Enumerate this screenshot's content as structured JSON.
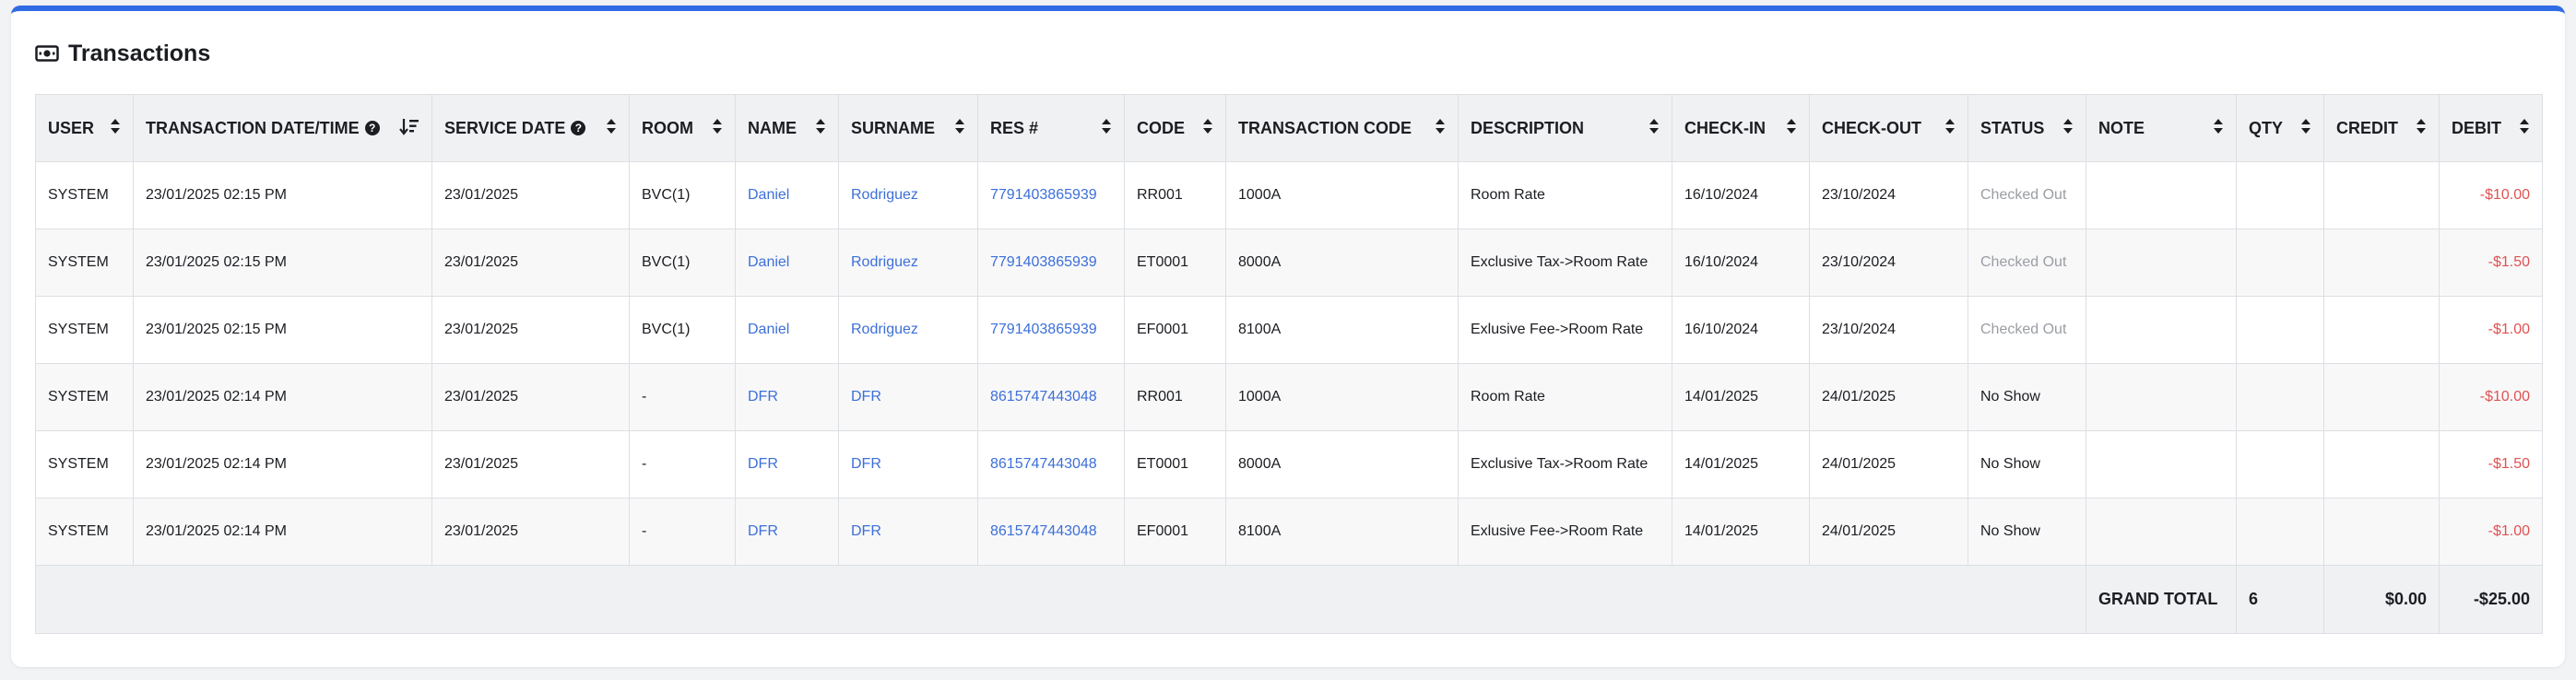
{
  "card": {
    "title": "Transactions",
    "icon": "money-bill-icon"
  },
  "columns": [
    {
      "key": "user",
      "label": "USER",
      "help": false,
      "sort": "both"
    },
    {
      "key": "txn_datetime",
      "label": "TRANSACTION DATE/TIME",
      "help": true,
      "sort": "desc"
    },
    {
      "key": "service_date",
      "label": "SERVICE DATE",
      "help": true,
      "sort": "both"
    },
    {
      "key": "room",
      "label": "ROOM",
      "help": false,
      "sort": "both"
    },
    {
      "key": "name",
      "label": "NAME",
      "help": false,
      "sort": "both"
    },
    {
      "key": "surname",
      "label": "SURNAME",
      "help": false,
      "sort": "both"
    },
    {
      "key": "res",
      "label": "RES #",
      "help": false,
      "sort": "both"
    },
    {
      "key": "code",
      "label": "CODE",
      "help": false,
      "sort": "both"
    },
    {
      "key": "txn_code",
      "label": "TRANSACTION CODE",
      "help": false,
      "sort": "both"
    },
    {
      "key": "description",
      "label": "DESCRIPTION",
      "help": false,
      "sort": "both"
    },
    {
      "key": "checkin",
      "label": "CHECK-IN",
      "help": false,
      "sort": "both"
    },
    {
      "key": "checkout",
      "label": "CHECK-OUT",
      "help": false,
      "sort": "both"
    },
    {
      "key": "status",
      "label": "STATUS",
      "help": false,
      "sort": "both"
    },
    {
      "key": "note",
      "label": "NOTE",
      "help": false,
      "sort": "both"
    },
    {
      "key": "qty",
      "label": "QTY",
      "help": false,
      "sort": "both"
    },
    {
      "key": "credit",
      "label": "CREDIT",
      "help": false,
      "sort": "both"
    },
    {
      "key": "debit",
      "label": "DEBIT",
      "help": false,
      "sort": "both"
    }
  ],
  "rows": [
    {
      "user": "SYSTEM",
      "txn_datetime": "23/01/2025 02:15 PM",
      "service_date": "23/01/2025",
      "room": "BVC(1)",
      "name": "Daniel",
      "surname": "Rodriguez",
      "res": "7791403865939",
      "code": "RR001",
      "txn_code": "1000A",
      "description": "Room Rate",
      "checkin": "16/10/2024",
      "checkout": "23/10/2024",
      "status": "Checked Out",
      "note": "",
      "qty": "",
      "credit": "",
      "debit": "-$10.00"
    },
    {
      "user": "SYSTEM",
      "txn_datetime": "23/01/2025 02:15 PM",
      "service_date": "23/01/2025",
      "room": "BVC(1)",
      "name": "Daniel",
      "surname": "Rodriguez",
      "res": "7791403865939",
      "code": "ET0001",
      "txn_code": "8000A",
      "description": "Exclusive Tax->Room Rate",
      "checkin": "16/10/2024",
      "checkout": "23/10/2024",
      "status": "Checked Out",
      "note": "",
      "qty": "",
      "credit": "",
      "debit": "-$1.50"
    },
    {
      "user": "SYSTEM",
      "txn_datetime": "23/01/2025 02:15 PM",
      "service_date": "23/01/2025",
      "room": "BVC(1)",
      "name": "Daniel",
      "surname": "Rodriguez",
      "res": "7791403865939",
      "code": "EF0001",
      "txn_code": "8100A",
      "description": "Exlusive Fee->Room Rate",
      "checkin": "16/10/2024",
      "checkout": "23/10/2024",
      "status": "Checked Out",
      "note": "",
      "qty": "",
      "credit": "",
      "debit": "-$1.00"
    },
    {
      "user": "SYSTEM",
      "txn_datetime": "23/01/2025 02:14 PM",
      "service_date": "23/01/2025",
      "room": "-",
      "name": "DFR",
      "surname": "DFR",
      "res": "8615747443048",
      "code": "RR001",
      "txn_code": "1000A",
      "description": "Room Rate",
      "checkin": "14/01/2025",
      "checkout": "24/01/2025",
      "status": "No Show",
      "note": "",
      "qty": "",
      "credit": "",
      "debit": "-$10.00"
    },
    {
      "user": "SYSTEM",
      "txn_datetime": "23/01/2025 02:14 PM",
      "service_date": "23/01/2025",
      "room": "-",
      "name": "DFR",
      "surname": "DFR",
      "res": "8615747443048",
      "code": "ET0001",
      "txn_code": "8000A",
      "description": "Exclusive Tax->Room Rate",
      "checkin": "14/01/2025",
      "checkout": "24/01/2025",
      "status": "No Show",
      "note": "",
      "qty": "",
      "credit": "",
      "debit": "-$1.50"
    },
    {
      "user": "SYSTEM",
      "txn_datetime": "23/01/2025 02:14 PM",
      "service_date": "23/01/2025",
      "room": "-",
      "name": "DFR",
      "surname": "DFR",
      "res": "8615747443048",
      "code": "EF0001",
      "txn_code": "8100A",
      "description": "Exlusive Fee->Room Rate",
      "checkin": "14/01/2025",
      "checkout": "24/01/2025",
      "status": "No Show",
      "note": "",
      "qty": "",
      "credit": "",
      "debit": "-$1.00"
    }
  ],
  "totals": {
    "label": "GRAND TOTAL",
    "qty": "6",
    "credit": "$0.00",
    "debit": "-$25.00"
  },
  "colors": {
    "accent": "#2f6be3",
    "link": "#3c6fd9",
    "debit": "#e05252",
    "muted_status": "#9a9da3",
    "header_bg": "#f0f1f3"
  }
}
